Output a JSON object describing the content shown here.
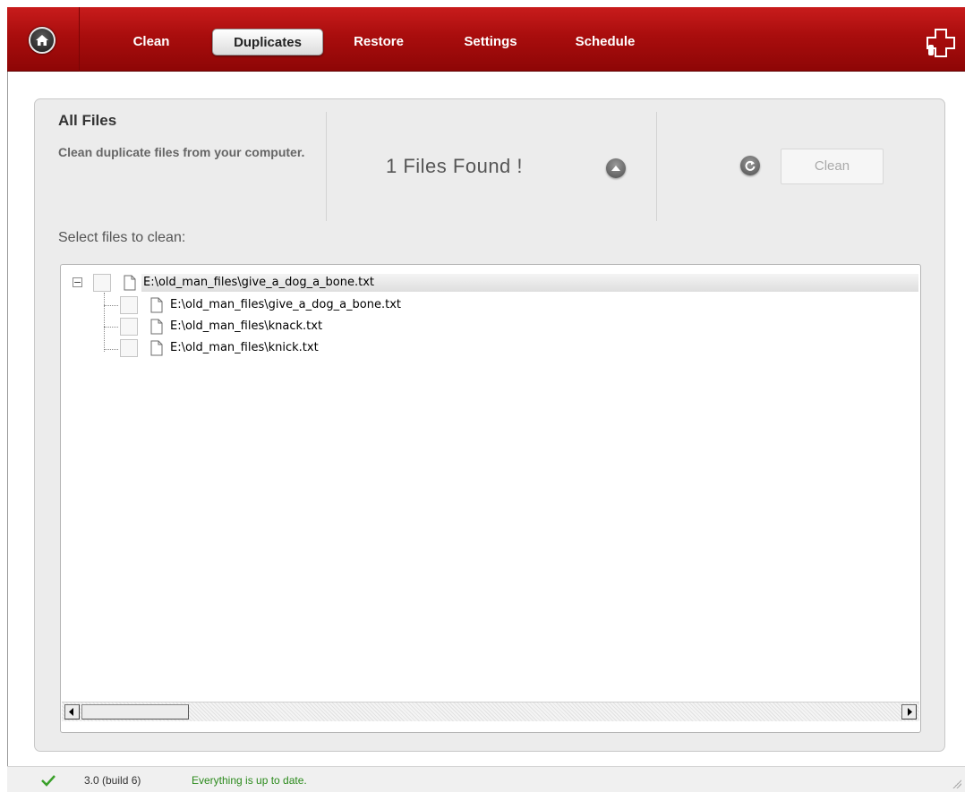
{
  "nav": {
    "items": [
      {
        "label": "Clean"
      },
      {
        "label": "Duplicates",
        "active": true
      },
      {
        "label": "Restore"
      },
      {
        "label": "Settings"
      },
      {
        "label": "Schedule"
      }
    ],
    "home_icon": "home-icon",
    "brand_icon": "plus-cross-icon"
  },
  "panel": {
    "title": "All Files",
    "description": "Clean duplicate files from your computer.",
    "files_found": "1  Files Found !",
    "clean_button": "Clean",
    "select_label": "Select files to clean:"
  },
  "tree": {
    "root": {
      "path": "E:\\old_man_files\\give_a_dog_a_bone.txt",
      "expanded": true
    },
    "children": [
      {
        "path": "E:\\old_man_files\\give_a_dog_a_bone.txt"
      },
      {
        "path": "E:\\old_man_files\\knack.txt"
      },
      {
        "path": "E:\\old_man_files\\knick.txt"
      }
    ]
  },
  "status": {
    "version": "3.0 (build 6)",
    "message": "Everything is up to date."
  },
  "colors": {
    "topbar": "#a90d0d",
    "status_ok": "#2b8a1c"
  }
}
